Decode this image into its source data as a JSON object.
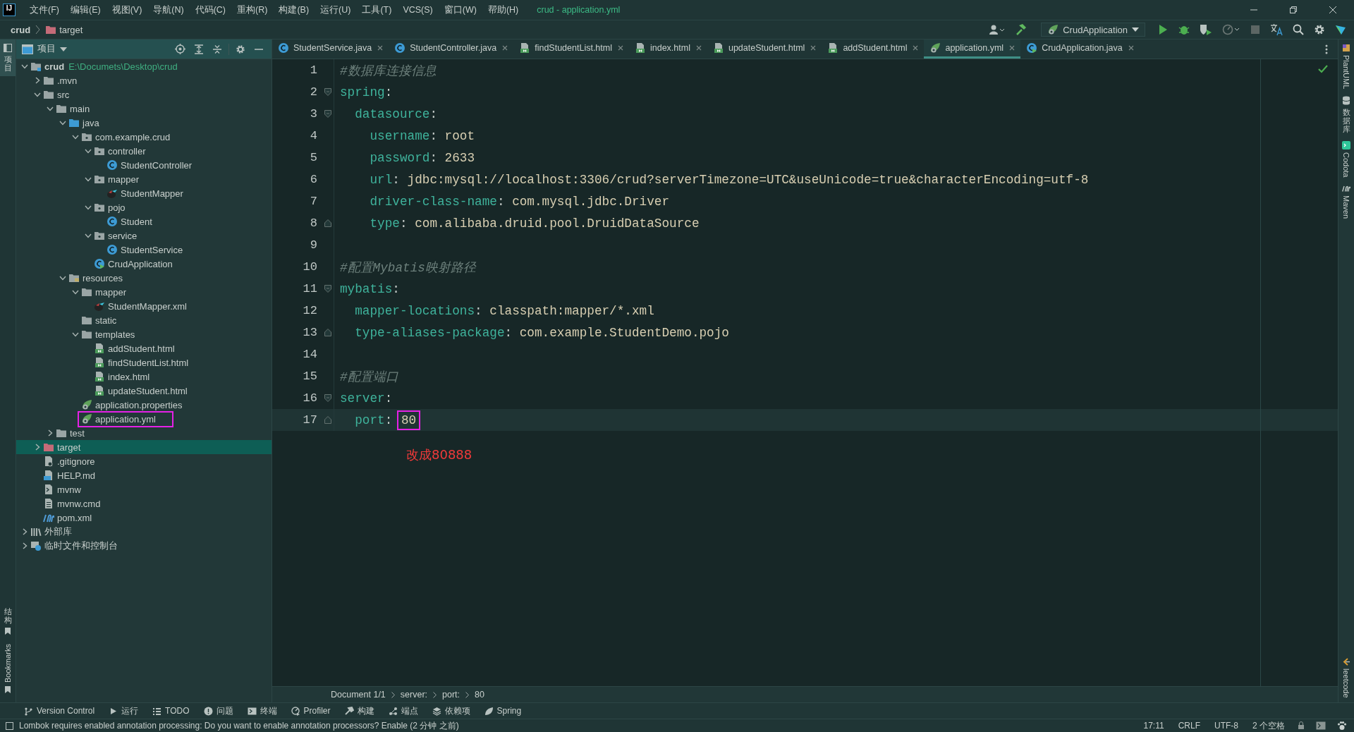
{
  "menu_bar": {
    "logo": "IJ",
    "items": [
      "文件(F)",
      "编辑(E)",
      "视图(V)",
      "导航(N)",
      "代码(C)",
      "重构(R)",
      "构建(B)",
      "运行(U)",
      "工具(T)",
      "VCS(S)",
      "窗口(W)",
      "帮助(H)"
    ],
    "title": "crud - application.yml"
  },
  "nav_bar": {
    "crumbs": [
      {
        "text": "crud",
        "kind": "project"
      },
      {
        "text": "target",
        "kind": "excluded"
      }
    ],
    "run_config": "CrudApplication"
  },
  "left_strip": [
    {
      "label": "项目",
      "selected": true,
      "kind": "top"
    },
    {
      "label": "结构",
      "selected": false,
      "kind": "bottom"
    },
    {
      "label": "Bookmarks",
      "selected": false,
      "kind": "bottom"
    }
  ],
  "project_panel": {
    "title": "项目",
    "tree": [
      {
        "label": "crud",
        "kind": "module",
        "path": "E:\\Documets\\Desktop\\crud",
        "expanded": true,
        "selected": false,
        "boxed": false,
        "children": [
          {
            "label": ".mvn",
            "kind": "folder",
            "expanded": false,
            "selected": false,
            "boxed": false
          },
          {
            "label": "src",
            "kind": "folder",
            "expanded": true,
            "selected": false,
            "boxed": false,
            "children": [
              {
                "label": "main",
                "kind": "folder",
                "expanded": true,
                "selected": false,
                "boxed": false,
                "children": [
                  {
                    "label": "java",
                    "kind": "source",
                    "expanded": true,
                    "selected": false,
                    "boxed": false,
                    "children": [
                      {
                        "label": "com.example.crud",
                        "kind": "package",
                        "expanded": true,
                        "selected": false,
                        "boxed": false,
                        "children": [
                          {
                            "label": "controller",
                            "kind": "package",
                            "expanded": true,
                            "selected": false,
                            "boxed": false,
                            "children": [
                              {
                                "label": "StudentController",
                                "kind": "class",
                                "selected": false,
                                "boxed": false
                              }
                            ]
                          },
                          {
                            "label": "mapper",
                            "kind": "package",
                            "expanded": true,
                            "selected": false,
                            "boxed": false,
                            "children": [
                              {
                                "label": "StudentMapper",
                                "kind": "mybatis",
                                "selected": false,
                                "boxed": false
                              }
                            ]
                          },
                          {
                            "label": "pojo",
                            "kind": "package",
                            "expanded": true,
                            "selected": false,
                            "boxed": false,
                            "children": [
                              {
                                "label": "Student",
                                "kind": "class",
                                "selected": false,
                                "boxed": false
                              }
                            ]
                          },
                          {
                            "label": "service",
                            "kind": "package",
                            "expanded": true,
                            "selected": false,
                            "boxed": false,
                            "children": [
                              {
                                "label": "StudentService",
                                "kind": "class",
                                "selected": false,
                                "boxed": false
                              }
                            ]
                          },
                          {
                            "label": "CrudApplication",
                            "kind": "app",
                            "selected": false,
                            "boxed": false
                          }
                        ]
                      }
                    ]
                  },
                  {
                    "label": "resources",
                    "kind": "resources",
                    "expanded": true,
                    "selected": false,
                    "boxed": false,
                    "children": [
                      {
                        "label": "mapper",
                        "kind": "folder",
                        "expanded": true,
                        "selected": false,
                        "boxed": false,
                        "children": [
                          {
                            "label": "StudentMapper.xml",
                            "kind": "mybatis",
                            "selected": false,
                            "boxed": false
                          }
                        ]
                      },
                      {
                        "label": "static",
                        "kind": "folder",
                        "selected": false,
                        "boxed": false
                      },
                      {
                        "label": "templates",
                        "kind": "folder",
                        "expanded": true,
                        "selected": false,
                        "boxed": false,
                        "children": [
                          {
                            "label": "addStudent.html",
                            "kind": "html",
                            "selected": false,
                            "boxed": false
                          },
                          {
                            "label": "findStudentList.html",
                            "kind": "html",
                            "selected": false,
                            "boxed": false
                          },
                          {
                            "label": "index.html",
                            "kind": "html",
                            "selected": false,
                            "boxed": false
                          },
                          {
                            "label": "updateStudent.html",
                            "kind": "html",
                            "selected": false,
                            "boxed": false
                          }
                        ]
                      },
                      {
                        "label": "application.properties",
                        "kind": "config",
                        "selected": false,
                        "boxed": false
                      },
                      {
                        "label": "application.yml",
                        "kind": "config",
                        "selected": false,
                        "boxed": true
                      }
                    ]
                  }
                ]
              },
              {
                "label": "test",
                "kind": "folder",
                "expanded": false,
                "selected": false,
                "boxed": false
              }
            ]
          },
          {
            "label": "target",
            "kind": "excluded",
            "expanded": false,
            "selected": true,
            "boxed": false
          },
          {
            "label": ".gitignore",
            "kind": "ignore",
            "selected": false,
            "boxed": false
          },
          {
            "label": "HELP.md",
            "kind": "md",
            "selected": false,
            "boxed": false
          },
          {
            "label": "mvnw",
            "kind": "shell",
            "selected": false,
            "boxed": false
          },
          {
            "label": "mvnw.cmd",
            "kind": "text",
            "selected": false,
            "boxed": false
          },
          {
            "label": "pom.xml",
            "kind": "maven",
            "selected": false,
            "boxed": false
          }
        ]
      },
      {
        "label": "外部库",
        "kind": "libraries",
        "expanded": false,
        "selected": false,
        "boxed": false
      },
      {
        "label": "临时文件和控制台",
        "kind": "scratches",
        "expanded": false,
        "selected": false,
        "boxed": false
      }
    ]
  },
  "tabs": [
    {
      "label": "StudentService.java",
      "kind": "class",
      "selected": false
    },
    {
      "label": "StudentController.java",
      "kind": "class",
      "selected": false
    },
    {
      "label": "findStudentList.html",
      "kind": "html",
      "selected": false
    },
    {
      "label": "index.html",
      "kind": "html",
      "selected": false
    },
    {
      "label": "updateStudent.html",
      "kind": "html",
      "selected": false
    },
    {
      "label": "addStudent.html",
      "kind": "html",
      "selected": false
    },
    {
      "label": "application.yml",
      "kind": "config",
      "selected": true
    },
    {
      "label": "CrudApplication.java",
      "kind": "app",
      "selected": false
    }
  ],
  "editor": {
    "lines": [
      {
        "number": "1",
        "kind": "plain",
        "current": false,
        "segments": [
          {
            "kind": "comment",
            "text": "#数据库连接信息",
            "boxed": false
          }
        ]
      },
      {
        "number": "2",
        "kind": "fold-start",
        "current": false,
        "segments": [
          {
            "kind": "key",
            "text": "spring",
            "boxed": false
          },
          {
            "kind": "colon",
            "text": ":",
            "boxed": false
          }
        ]
      },
      {
        "number": "3",
        "kind": "fold-start",
        "current": false,
        "segments": [
          {
            "kind": "key",
            "text": "  datasource",
            "boxed": false
          },
          {
            "kind": "colon",
            "text": ":",
            "boxed": false
          }
        ]
      },
      {
        "number": "4",
        "kind": "plain",
        "current": false,
        "segments": [
          {
            "kind": "key",
            "text": "    username",
            "boxed": false
          },
          {
            "kind": "colon",
            "text": ": ",
            "boxed": false
          },
          {
            "kind": "value",
            "text": "root",
            "boxed": false
          }
        ]
      },
      {
        "number": "5",
        "kind": "plain",
        "current": false,
        "segments": [
          {
            "kind": "key",
            "text": "    password",
            "boxed": false
          },
          {
            "kind": "colon",
            "text": ": ",
            "boxed": false
          },
          {
            "kind": "value",
            "text": "2633",
            "boxed": false
          }
        ]
      },
      {
        "number": "6",
        "kind": "plain",
        "current": false,
        "segments": [
          {
            "kind": "key",
            "text": "    url",
            "boxed": false
          },
          {
            "kind": "colon",
            "text": ": ",
            "boxed": false
          },
          {
            "kind": "value",
            "text": "jdbc:mysql://localhost:3306/crud?serverTimezone=UTC&useUnicode=true&characterEncoding=utf-8",
            "boxed": false
          }
        ]
      },
      {
        "number": "7",
        "kind": "plain",
        "current": false,
        "segments": [
          {
            "kind": "key",
            "text": "    driver-class-name",
            "boxed": false
          },
          {
            "kind": "colon",
            "text": ": ",
            "boxed": false
          },
          {
            "kind": "value",
            "text": "com.mysql.jdbc.Driver",
            "boxed": false
          }
        ]
      },
      {
        "number": "8",
        "kind": "fold-end",
        "current": false,
        "segments": [
          {
            "kind": "key",
            "text": "    type",
            "boxed": false
          },
          {
            "kind": "colon",
            "text": ": ",
            "boxed": false
          },
          {
            "kind": "value",
            "text": "com.alibaba.druid.pool.DruidDataSource",
            "boxed": false
          }
        ]
      },
      {
        "number": "9",
        "kind": "plain",
        "current": false
      },
      {
        "number": "10",
        "kind": "plain",
        "current": false,
        "segments": [
          {
            "kind": "comment",
            "text": "#配置Mybatis映射路径",
            "boxed": false
          }
        ]
      },
      {
        "number": "11",
        "kind": "fold-start",
        "current": false,
        "segments": [
          {
            "kind": "key",
            "text": "mybatis",
            "boxed": false
          },
          {
            "kind": "colon",
            "text": ":",
            "boxed": false
          }
        ]
      },
      {
        "number": "12",
        "kind": "plain",
        "current": false,
        "segments": [
          {
            "kind": "key",
            "text": "  mapper-locations",
            "boxed": false
          },
          {
            "kind": "colon",
            "text": ": ",
            "boxed": false
          },
          {
            "kind": "value",
            "text": "classpath:mapper/*.xml",
            "boxed": false
          }
        ]
      },
      {
        "number": "13",
        "kind": "fold-end",
        "current": false,
        "segments": [
          {
            "kind": "key",
            "text": "  type-aliases-package",
            "boxed": false
          },
          {
            "kind": "colon",
            "text": ": ",
            "boxed": false
          },
          {
            "kind": "value",
            "text": "com.example.StudentDemo.pojo",
            "boxed": false
          }
        ]
      },
      {
        "number": "14",
        "kind": "plain",
        "current": false
      },
      {
        "number": "15",
        "kind": "plain",
        "current": false,
        "segments": [
          {
            "kind": "comment",
            "text": "#配置端口",
            "boxed": false
          }
        ]
      },
      {
        "number": "16",
        "kind": "fold-start",
        "current": false,
        "segments": [
          {
            "kind": "key",
            "text": "server",
            "boxed": false
          },
          {
            "kind": "colon",
            "text": ":",
            "boxed": false
          }
        ]
      },
      {
        "number": "17",
        "kind": "fold-end",
        "current": true,
        "segments": [
          {
            "kind": "key",
            "text": "  port",
            "boxed": false
          },
          {
            "kind": "colon",
            "text": ": ",
            "boxed": false
          },
          {
            "kind": "value",
            "text": "80",
            "boxed": true
          }
        ]
      }
    ],
    "annotation": "改成80888",
    "breadcrumb": [
      "Document 1/1",
      "server:",
      "port:",
      "80"
    ]
  },
  "right_strip": [
    {
      "label": "PlantUML",
      "kind": "plantuml"
    },
    {
      "label": "数据库",
      "kind": "database"
    },
    {
      "label": "Codota",
      "kind": "codota"
    },
    {
      "label": "Maven",
      "kind": "maven"
    },
    {
      "label": "leetcode",
      "kind": "leetcode"
    }
  ],
  "tool_bar": [
    {
      "label": "Version Control",
      "kind": "vcs"
    },
    {
      "label": "运行",
      "kind": "run"
    },
    {
      "label": "TODO",
      "kind": "todo"
    },
    {
      "label": "问题",
      "kind": "problems"
    },
    {
      "label": "终端",
      "kind": "terminal"
    },
    {
      "label": "Profiler",
      "kind": "profiler"
    },
    {
      "label": "构建",
      "kind": "build"
    },
    {
      "label": "端点",
      "kind": "endpoints"
    },
    {
      "label": "依赖项",
      "kind": "deps"
    },
    {
      "label": "Spring",
      "kind": "spring"
    }
  ],
  "status_bar": {
    "message": "Lombok requires enabled annotation processing: Do you want to enable annotation processors? Enable (2 分钟 之前)",
    "items": [
      "17:11",
      "CRLF",
      "UTF-8",
      "2 个空格"
    ]
  }
}
